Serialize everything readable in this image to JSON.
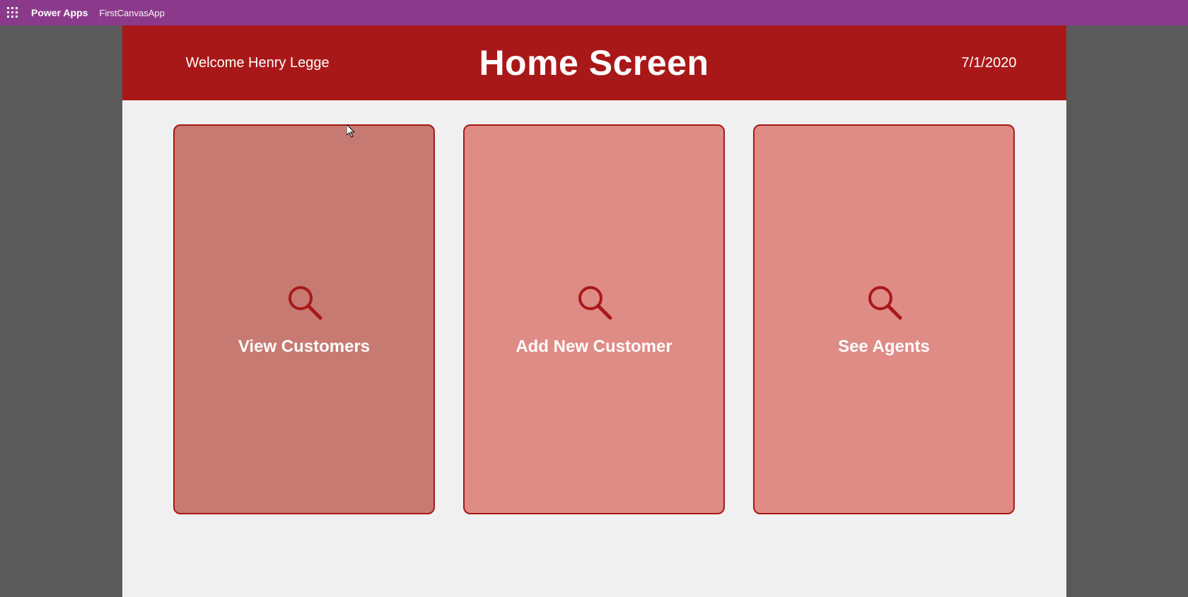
{
  "topbar": {
    "brand": "Power Apps",
    "app_name": "FirstCanvasApp"
  },
  "header": {
    "welcome": "Welcome Henry Legge",
    "title": "Home Screen",
    "date": "7/1/2020"
  },
  "tiles": [
    {
      "label": "View Customers",
      "icon": "search",
      "hover": true
    },
    {
      "label": "Add New Customer",
      "icon": "search",
      "hover": false
    },
    {
      "label": "See Agents",
      "icon": "search",
      "hover": false
    }
  ],
  "colors": {
    "topbar_bg": "#8b3a8b",
    "banner_bg": "#a91818",
    "tile_bg": "#df8b86",
    "tile_hover_bg": "#c67a72",
    "tile_border": "#a91818",
    "canvas_bg": "#f0f0f0",
    "viewport_bg": "#5a5a5a"
  }
}
